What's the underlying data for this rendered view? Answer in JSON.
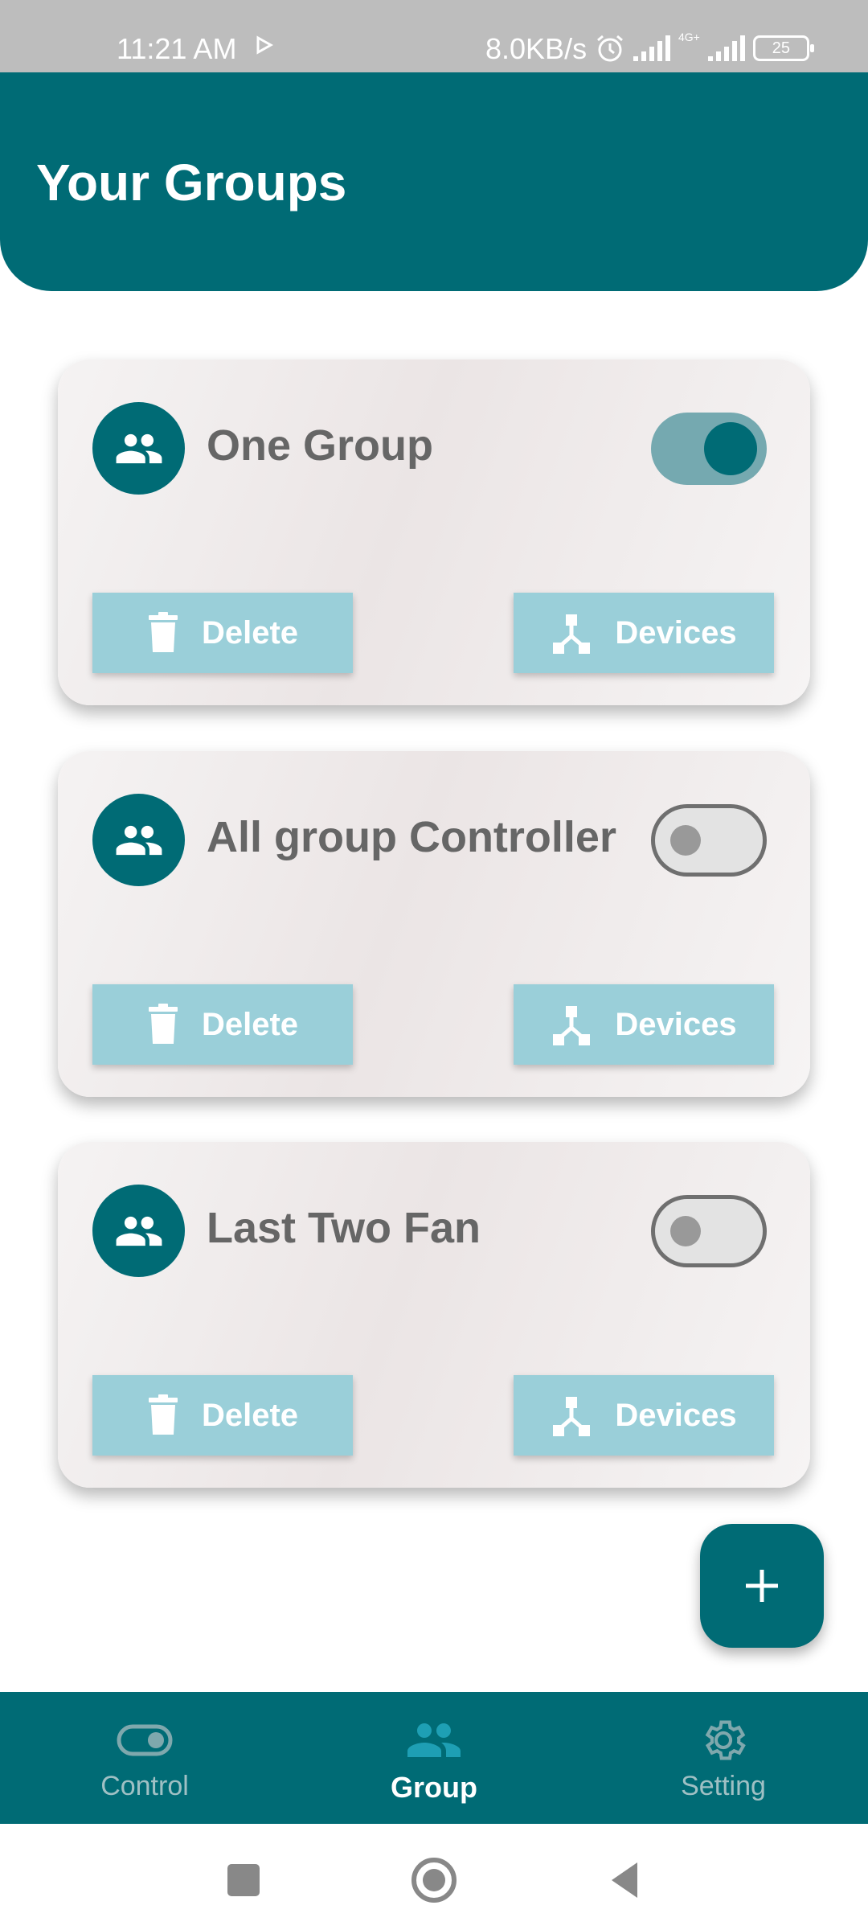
{
  "status_bar": {
    "time": "11:21 AM",
    "speed": "8.0KB/s",
    "network": "4G+",
    "battery": "25"
  },
  "header": {
    "title": "Your Groups"
  },
  "groups": [
    {
      "name": "One Group",
      "enabled": true,
      "delete_label": "Delete",
      "devices_label": "Devices"
    },
    {
      "name": "All group Controller",
      "enabled": false,
      "delete_label": "Delete",
      "devices_label": "Devices"
    },
    {
      "name": "Last Two Fan",
      "enabled": false,
      "delete_label": "Delete",
      "devices_label": "Devices"
    }
  ],
  "fab": {
    "icon": "plus-icon"
  },
  "bottom_nav": {
    "items": [
      {
        "label": "Control",
        "icon": "toggle-icon",
        "active": false
      },
      {
        "label": "Group",
        "icon": "group-icon",
        "active": true
      },
      {
        "label": "Setting",
        "icon": "gear-icon",
        "active": false
      }
    ]
  },
  "colors": {
    "primary": "#006b75",
    "button": "#9acfd9",
    "toggle_on_track": "#75a9b0",
    "card_text": "#666666"
  }
}
